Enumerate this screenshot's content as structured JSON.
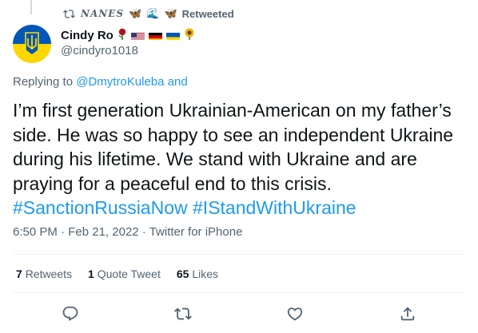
{
  "retweet_header": {
    "retweeter_name": "NANES",
    "decor": [
      "🦋",
      "🌊",
      "🦋"
    ],
    "label": "Retweeted"
  },
  "author": {
    "display_name": "Cindy Ro",
    "handle": "@cindyro1018",
    "emoji": [
      "🌹",
      "🇺🇸",
      "🇩🇪",
      "🇺🇦",
      "🌻"
    ]
  },
  "replying": {
    "prefix": "Replying to",
    "mention": "@DmytroKuleba",
    "suffix": "and"
  },
  "tweet": {
    "body": "I’m first generation Ukrainian-American on my father’s side. He was so happy to see an independent Ukraine during his lifetime. We stand with Ukraine and are praying for a peaceful end to this crisis.",
    "hashtag1": "#SanctionRussiaNow",
    "hashtag2": "#IStandWithUkraine"
  },
  "meta": {
    "time": "6:50 PM",
    "date": "Feb 21, 2022",
    "source": "Twitter for iPhone"
  },
  "stats": {
    "retweets_count": "7",
    "retweets_label": "Retweets",
    "quotes_count": "1",
    "quotes_label": "Quote Tweet",
    "likes_count": "65",
    "likes_label": "Likes"
  },
  "colors": {
    "accent": "#1d9bf0",
    "secondary_text": "#536471",
    "ukraine_blue": "#0057b7",
    "ukraine_yellow": "#ffd700"
  },
  "icons": [
    "retweet-icon",
    "reply-icon",
    "retweet-action-icon",
    "like-icon",
    "share-icon"
  ]
}
